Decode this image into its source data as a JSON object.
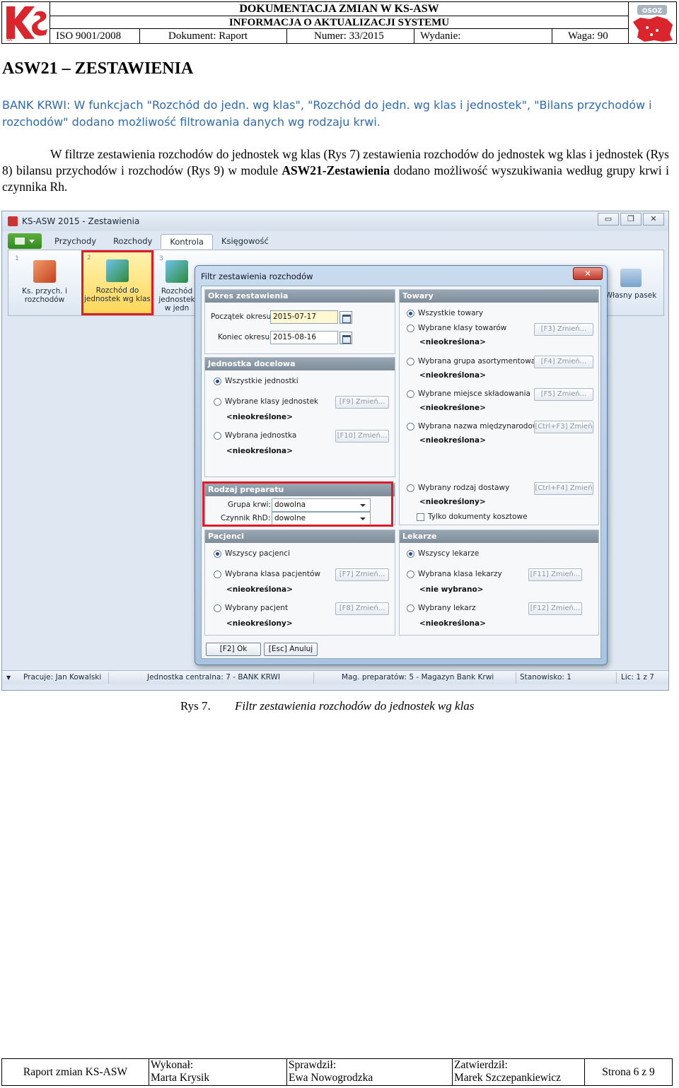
{
  "header": {
    "title1": "DOKUMENTACJA ZMIAN W KS-ASW",
    "title2": "INFORMACJA O AKTUALIZACJI SYSTEMU",
    "iso": "ISO 9001/2008",
    "dokument": "Dokument: Raport",
    "numer": "Numer: 33/2015",
    "wydanie": "Wydanie:",
    "waga": "Waga: 90"
  },
  "section_title": "ASW21 – ZESTAWIENIA",
  "blue_note": "BANK KRWI: W funkcjach \"Rozchód do jedn. wg klas\", \"Rozchód do jedn. wg klas i jednostek\", \"Bilans przychodów i rozchodów\" dodano możliwość filtrowania danych wg rodzaju krwi.",
  "para": {
    "before": "W filtrze zestawienia rozchodów do jednostek wg klas (Rys 7) zestawienia rozchodów do jednostek wg klas i jednostek (Rys 8) bilansu przychodów i rozchodów (Rys 9) w module ",
    "bold": "ASW21-Zestawienia",
    "after": " dodano możliwość wyszukiwania według grupy krwi i czynnika Rh."
  },
  "app": {
    "window_title": "KS-ASW 2015 - Zestawienia",
    "tabs": [
      "Przychody",
      "Rozchody",
      "Kontrola",
      "Księgowość"
    ],
    "ribbon": {
      "b1_num": "1",
      "b1_label": "Ks. przych. i rozchodów",
      "b2_num": "2",
      "b2_label": "Rozchód do jednostek wg klas",
      "b3_num": "3",
      "b3_label": "Rozchód jednostek w jedn",
      "right_label": "Własny pasek"
    },
    "status": {
      "user": "Pracuje: Jan Kowalski",
      "unit": "Jednostka centralna: 7 - BANK KRWI",
      "mag": "Mag. preparatów: 5 - Magazyn Bank Krwi",
      "station": "Stanowisko: 1",
      "lic": "Lic: 1 z 7"
    }
  },
  "dialog": {
    "title": "Filtr zestawienia rozchodów",
    "okres": {
      "header": "Okres zestawienia",
      "start_label": "Początek okresu:",
      "start_value": "2015-07-17",
      "end_label": "Koniec okresu:",
      "end_value": "2015-08-16"
    },
    "jednostka": {
      "header": "Jednostka docelowa",
      "all": "Wszystkie jednostki",
      "klasy": "Wybrane klasy jednostek",
      "klasy_btn": "[F9] Zmień...",
      "klasy_val": "<nieokreślone>",
      "jedn": "Wybrana jednostka",
      "jedn_btn": "[F10] Zmień...",
      "jedn_val": "<nieokreślona>"
    },
    "preparat": {
      "header": "Rodzaj preparatu",
      "grupa_label": "Grupa krwi:",
      "grupa_value": "dowolna",
      "rh_label": "Czynnik RhD:",
      "rh_value": "dowolne"
    },
    "towary": {
      "header": "Towary",
      "all": "Wszystkie towary",
      "klasy": "Wybrane klasy towarów",
      "klasy_btn": "[F3] Zmień...",
      "klasy_val": "<nieokreślona>",
      "grupa": "Wybrana grupa asortymentowa",
      "grupa_btn": "[F4] Zmień...",
      "grupa_val": "<nieokreślona>",
      "miejsce": "Wybrane miejsce składowania",
      "miejsce_btn": "[F5] Zmień...",
      "miejsce_val": "<nieokreślone>",
      "nazwa": "Wybrana nazwa międzynarodowa",
      "nazwa_btn": "[Ctrl+F3] Zmień",
      "nazwa_val": "<nieokreślona>",
      "dostawa": "Wybrany rodzaj dostawy",
      "dostawa_btn": "[Ctrl+F4] Zmień",
      "dostawa_val": "<nieokreślony>",
      "koszt": "Tylko dokumenty kosztowe"
    },
    "pacjenci": {
      "header": "Pacjenci",
      "all": "Wszyscy pacjenci",
      "klasa": "Wybrana klasa pacjentów",
      "klasa_btn": "[F7] Zmień...",
      "klasa_val": "<nieokreślona>",
      "pacjent": "Wybrany pacjent",
      "pacjent_btn": "[F8] Zmień...",
      "pacjent_val": "<nieokreślony>"
    },
    "lekarze": {
      "header": "Lekarze",
      "all": "Wszyscy lekarze",
      "klasa": "Wybrana klasa lekarzy",
      "klasa_btn": "[F11] Zmień...",
      "klasa_val": "<nie wybrano>",
      "lekarz": "Wybrany lekarz",
      "lekarz_btn": "[F12] Zmień...",
      "lekarz_val": "<nieokreślona>"
    },
    "ok": "[F2] Ok",
    "cancel": "[Esc] Anuluj"
  },
  "caption": {
    "label": "Rys 7.",
    "text": "Filtr zestawienia rozchodów do jednostek wg klas"
  },
  "footer": {
    "report": "Raport zmian KS-ASW",
    "wykonal_label": "Wykonał:",
    "wykonal": "Marta Krysik",
    "sprawdzil_label": "Sprawdził:",
    "sprawdzil": "Ewa Nowogrodzka",
    "zatwierdzil_label": "Zatwierdził:",
    "zatwierdzil": "Marek Szczepankiewicz",
    "page": "Strona 6 z 9"
  },
  "colors": {
    "accent_red": "#e01b24",
    "note_blue": "#2e6bb5"
  }
}
